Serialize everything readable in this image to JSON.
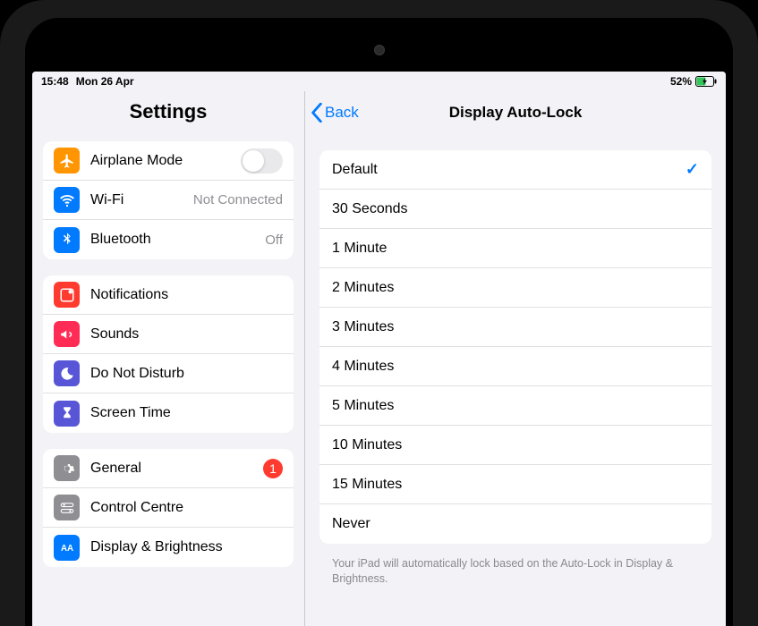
{
  "statusbar": {
    "time": "15:48",
    "date": "Mon 26 Apr",
    "battery_pct": "52%"
  },
  "sidebar": {
    "title": "Settings",
    "groups": [
      {
        "rows": [
          {
            "id": "airplane",
            "label": "Airplane Mode",
            "icon": "airplane",
            "iconColor": "ic-orange",
            "accessory": "toggle",
            "toggle": false
          },
          {
            "id": "wifi",
            "label": "Wi-Fi",
            "icon": "wifi",
            "iconColor": "ic-blue",
            "value": "Not Connected"
          },
          {
            "id": "bluetooth",
            "label": "Bluetooth",
            "icon": "bluetooth",
            "iconColor": "ic-blue",
            "value": "Off"
          }
        ]
      },
      {
        "rows": [
          {
            "id": "notifications",
            "label": "Notifications",
            "icon": "notifications",
            "iconColor": "ic-red"
          },
          {
            "id": "sounds",
            "label": "Sounds",
            "icon": "sounds",
            "iconColor": "ic-redpink"
          },
          {
            "id": "dnd",
            "label": "Do Not Disturb",
            "icon": "moon",
            "iconColor": "ic-indigo"
          },
          {
            "id": "screentime",
            "label": "Screen Time",
            "icon": "hourglass",
            "iconColor": "ic-indigo"
          }
        ]
      },
      {
        "rows": [
          {
            "id": "general",
            "label": "General",
            "icon": "gear",
            "iconColor": "ic-gray",
            "badge": "1"
          },
          {
            "id": "controlcentre",
            "label": "Control Centre",
            "icon": "switches",
            "iconColor": "ic-gray"
          },
          {
            "id": "display",
            "label": "Display & Brightness",
            "icon": "aa",
            "iconColor": "ic-bluea"
          }
        ]
      }
    ]
  },
  "detail": {
    "back": "Back",
    "title": "Display Auto-Lock",
    "options": [
      {
        "label": "Default",
        "selected": true
      },
      {
        "label": "30 Seconds",
        "selected": false
      },
      {
        "label": "1 Minute",
        "selected": false
      },
      {
        "label": "2 Minutes",
        "selected": false
      },
      {
        "label": "3 Minutes",
        "selected": false
      },
      {
        "label": "4 Minutes",
        "selected": false
      },
      {
        "label": "5 Minutes",
        "selected": false
      },
      {
        "label": "10 Minutes",
        "selected": false
      },
      {
        "label": "15 Minutes",
        "selected": false
      },
      {
        "label": "Never",
        "selected": false
      }
    ],
    "footer": "Your iPad will automatically lock based on the Auto-Lock in Display & Brightness."
  }
}
